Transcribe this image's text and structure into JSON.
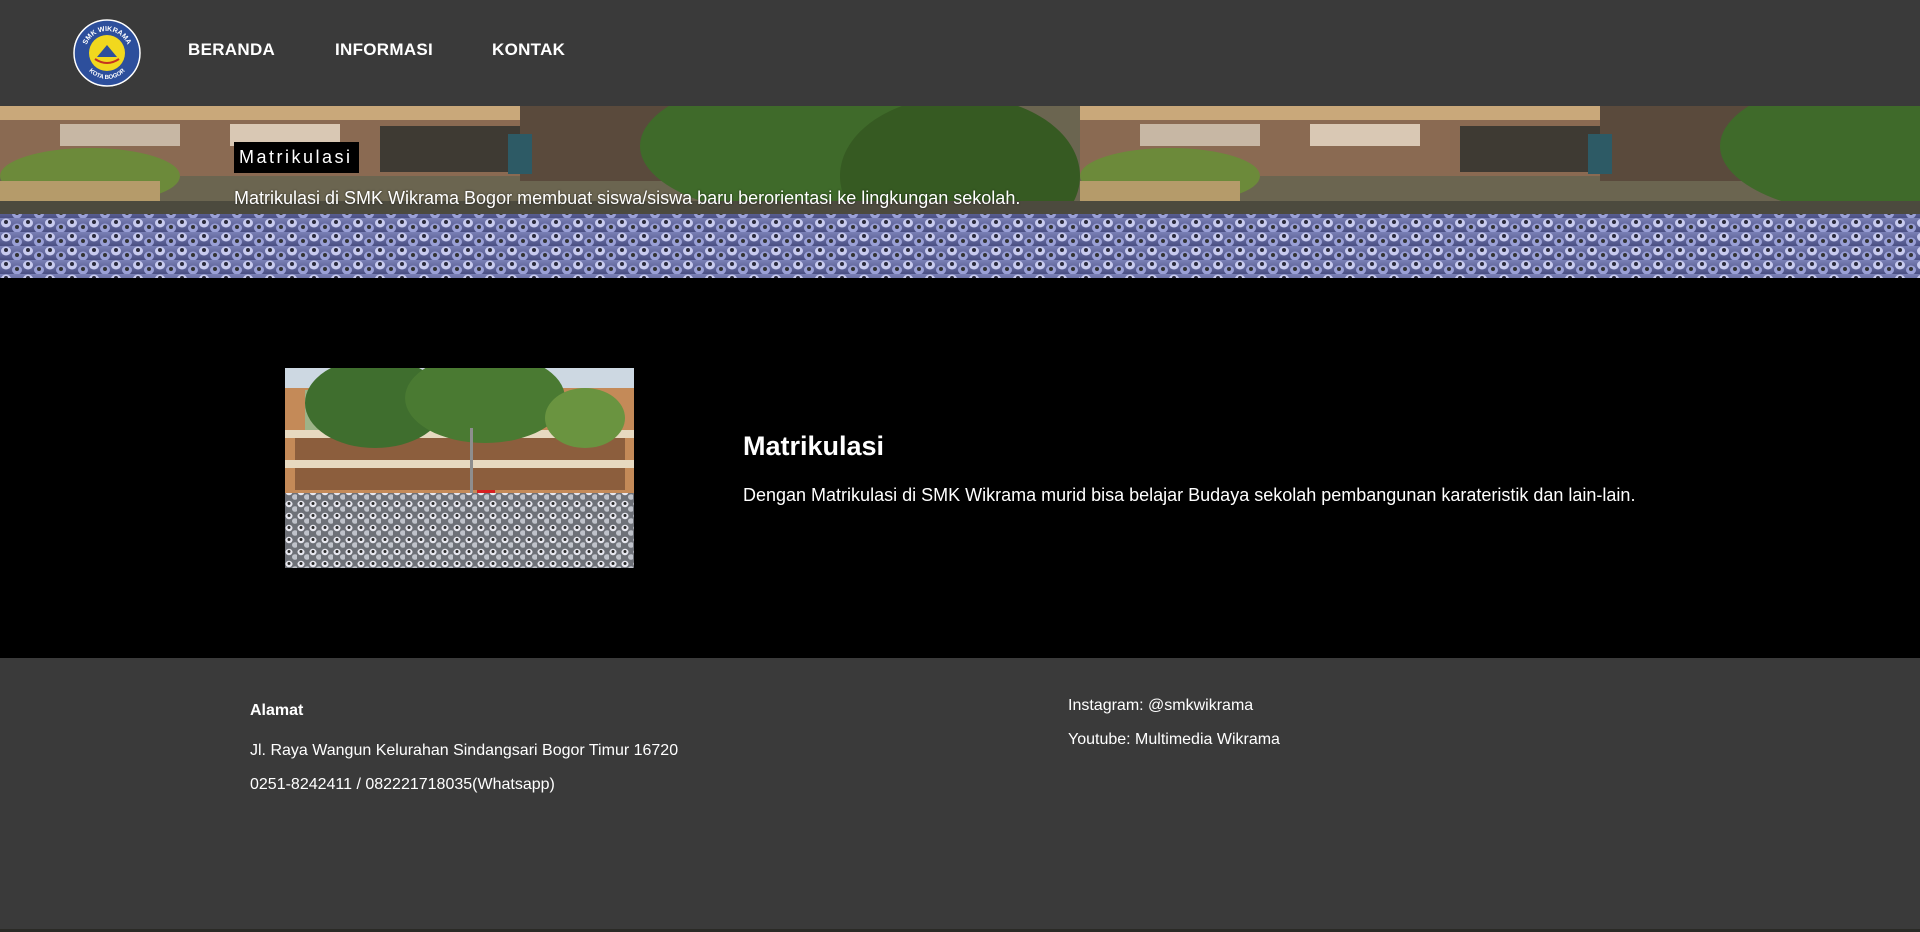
{
  "nav": {
    "logo_alt": "SMK WIKRAMA KOTA BOGOR",
    "logo_text_top": "SMK WIKRAMA",
    "logo_text_bottom": "KOTA BOGOR",
    "links": [
      {
        "label": "BERANDA"
      },
      {
        "label": "INFORMASI"
      },
      {
        "label": "KONTAK"
      }
    ]
  },
  "hero": {
    "badge": "Matrikulasi",
    "text": "Matrikulasi di SMK Wikrama Bogor membuat siswa/siswa baru berorientasi ke lingkungan sekolah."
  },
  "main": {
    "title": "Matrikulasi",
    "description": "Dengan Matrikulasi di SMK Wikrama murid bisa belajar Budaya sekolah pembangunan karateristik dan lain-lain."
  },
  "footer": {
    "address_heading": "Alamat",
    "address": "Jl. Raya Wangun Kelurahan Sindangsari Bogor Timur 16720",
    "phone": "0251-8242411 / 082221718035(Whatsapp)",
    "instagram": "Instagram: @smkwikrama",
    "youtube": "Youtube: Multimedia Wikrama"
  },
  "colors": {
    "nav_bg": "#3a3a3a",
    "main_bg": "#000000",
    "footer_bg": "#3a3a3a",
    "text": "#ffffff"
  }
}
